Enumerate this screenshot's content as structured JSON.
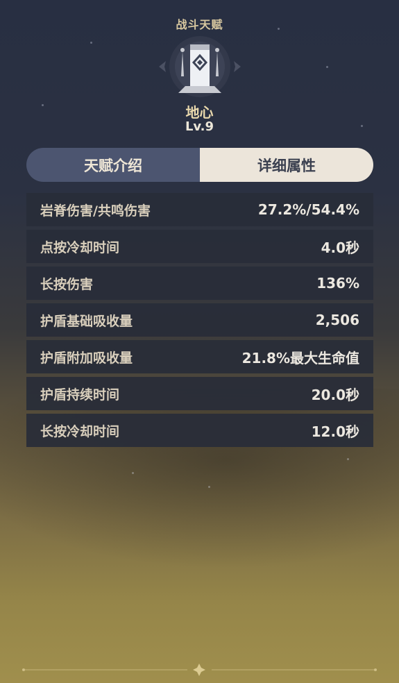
{
  "header": {
    "title": "战斗天赋"
  },
  "talent": {
    "icon": "shield-pillar-icon",
    "name": "地心",
    "level": "Lv.9"
  },
  "tabs": [
    {
      "label": "天赋介绍",
      "active": false
    },
    {
      "label": "详细属性",
      "active": true
    }
  ],
  "stats": [
    {
      "label": "岩脊伤害/共鸣伤害",
      "value": "27.2%/54.4%"
    },
    {
      "label": "点按冷却时间",
      "value": "4.0秒"
    },
    {
      "label": "长按伤害",
      "value": "136%"
    },
    {
      "label": "护盾基础吸收量",
      "value": "2,506"
    },
    {
      "label": "护盾附加吸收量",
      "value": "21.8%最大生命值"
    },
    {
      "label": "护盾持续时间",
      "value": "20.0秒"
    },
    {
      "label": "长按冷却时间",
      "value": "12.0秒"
    }
  ],
  "colors": {
    "background_top": "#282f42",
    "background_bottom": "#a08f4d",
    "tab_inactive": "#4c5570",
    "tab_active": "#ece5da",
    "accent_gold": "#d8c8a0"
  }
}
